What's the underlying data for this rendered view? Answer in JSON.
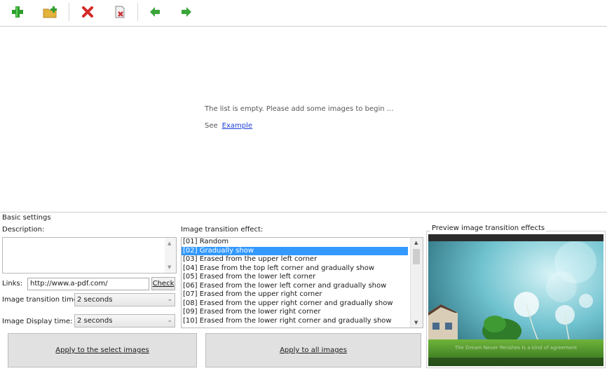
{
  "toolbar": {
    "buttons": [
      {
        "icon": "add-image-icon",
        "color": "#2e9e2e"
      },
      {
        "icon": "add-folder-icon",
        "color": "#e3b33a"
      },
      {
        "icon": "delete-icon",
        "color": "#d42a2a"
      },
      {
        "icon": "clear-list-icon",
        "color": "#c83232"
      },
      {
        "icon": "move-left-icon",
        "color": "#3aa53a"
      },
      {
        "icon": "move-right-icon",
        "color": "#3aa53a"
      }
    ]
  },
  "list": {
    "empty_message": "The list is empty. Please add some images to begin ...",
    "see_label": "See",
    "example_link": "Example"
  },
  "settings": {
    "title": "Basic settings",
    "description_label": "Description:",
    "description_value": "",
    "links_label": "Links:",
    "links_value": "http://www.a-pdf.com/",
    "check_label": "Check",
    "transition_time_label": "Image transition time:",
    "transition_time_value": "2 seconds",
    "display_time_label": "Image Display time:",
    "display_time_value": "2 seconds"
  },
  "effects": {
    "label": "Image transition effect:",
    "selected_index": 1,
    "items": [
      "[01] Random",
      "[02] Gradually show",
      "[03] Erased from the upper left corner",
      "[04] Erase from the top left corner and gradually show",
      "[05] Erased from the lower left corner",
      "[06] Erased from the lower left corner and gradually show",
      "[07] Erased from the upper right corner",
      "[08] Erased from the upper right corner and gradually show",
      "[09] Erased from the lower right corner",
      "[10] Erased from the lower right corner and gradually show"
    ]
  },
  "preview": {
    "title": "Preview image transition effects",
    "caption": "The Dream Never Perishes Is a kind of agreement"
  },
  "actions": {
    "apply_selected": "Apply to the select images",
    "apply_all": "Apply to all images"
  },
  "colors": {
    "selection": "#3399ff",
    "link": "#1a3fd6"
  }
}
